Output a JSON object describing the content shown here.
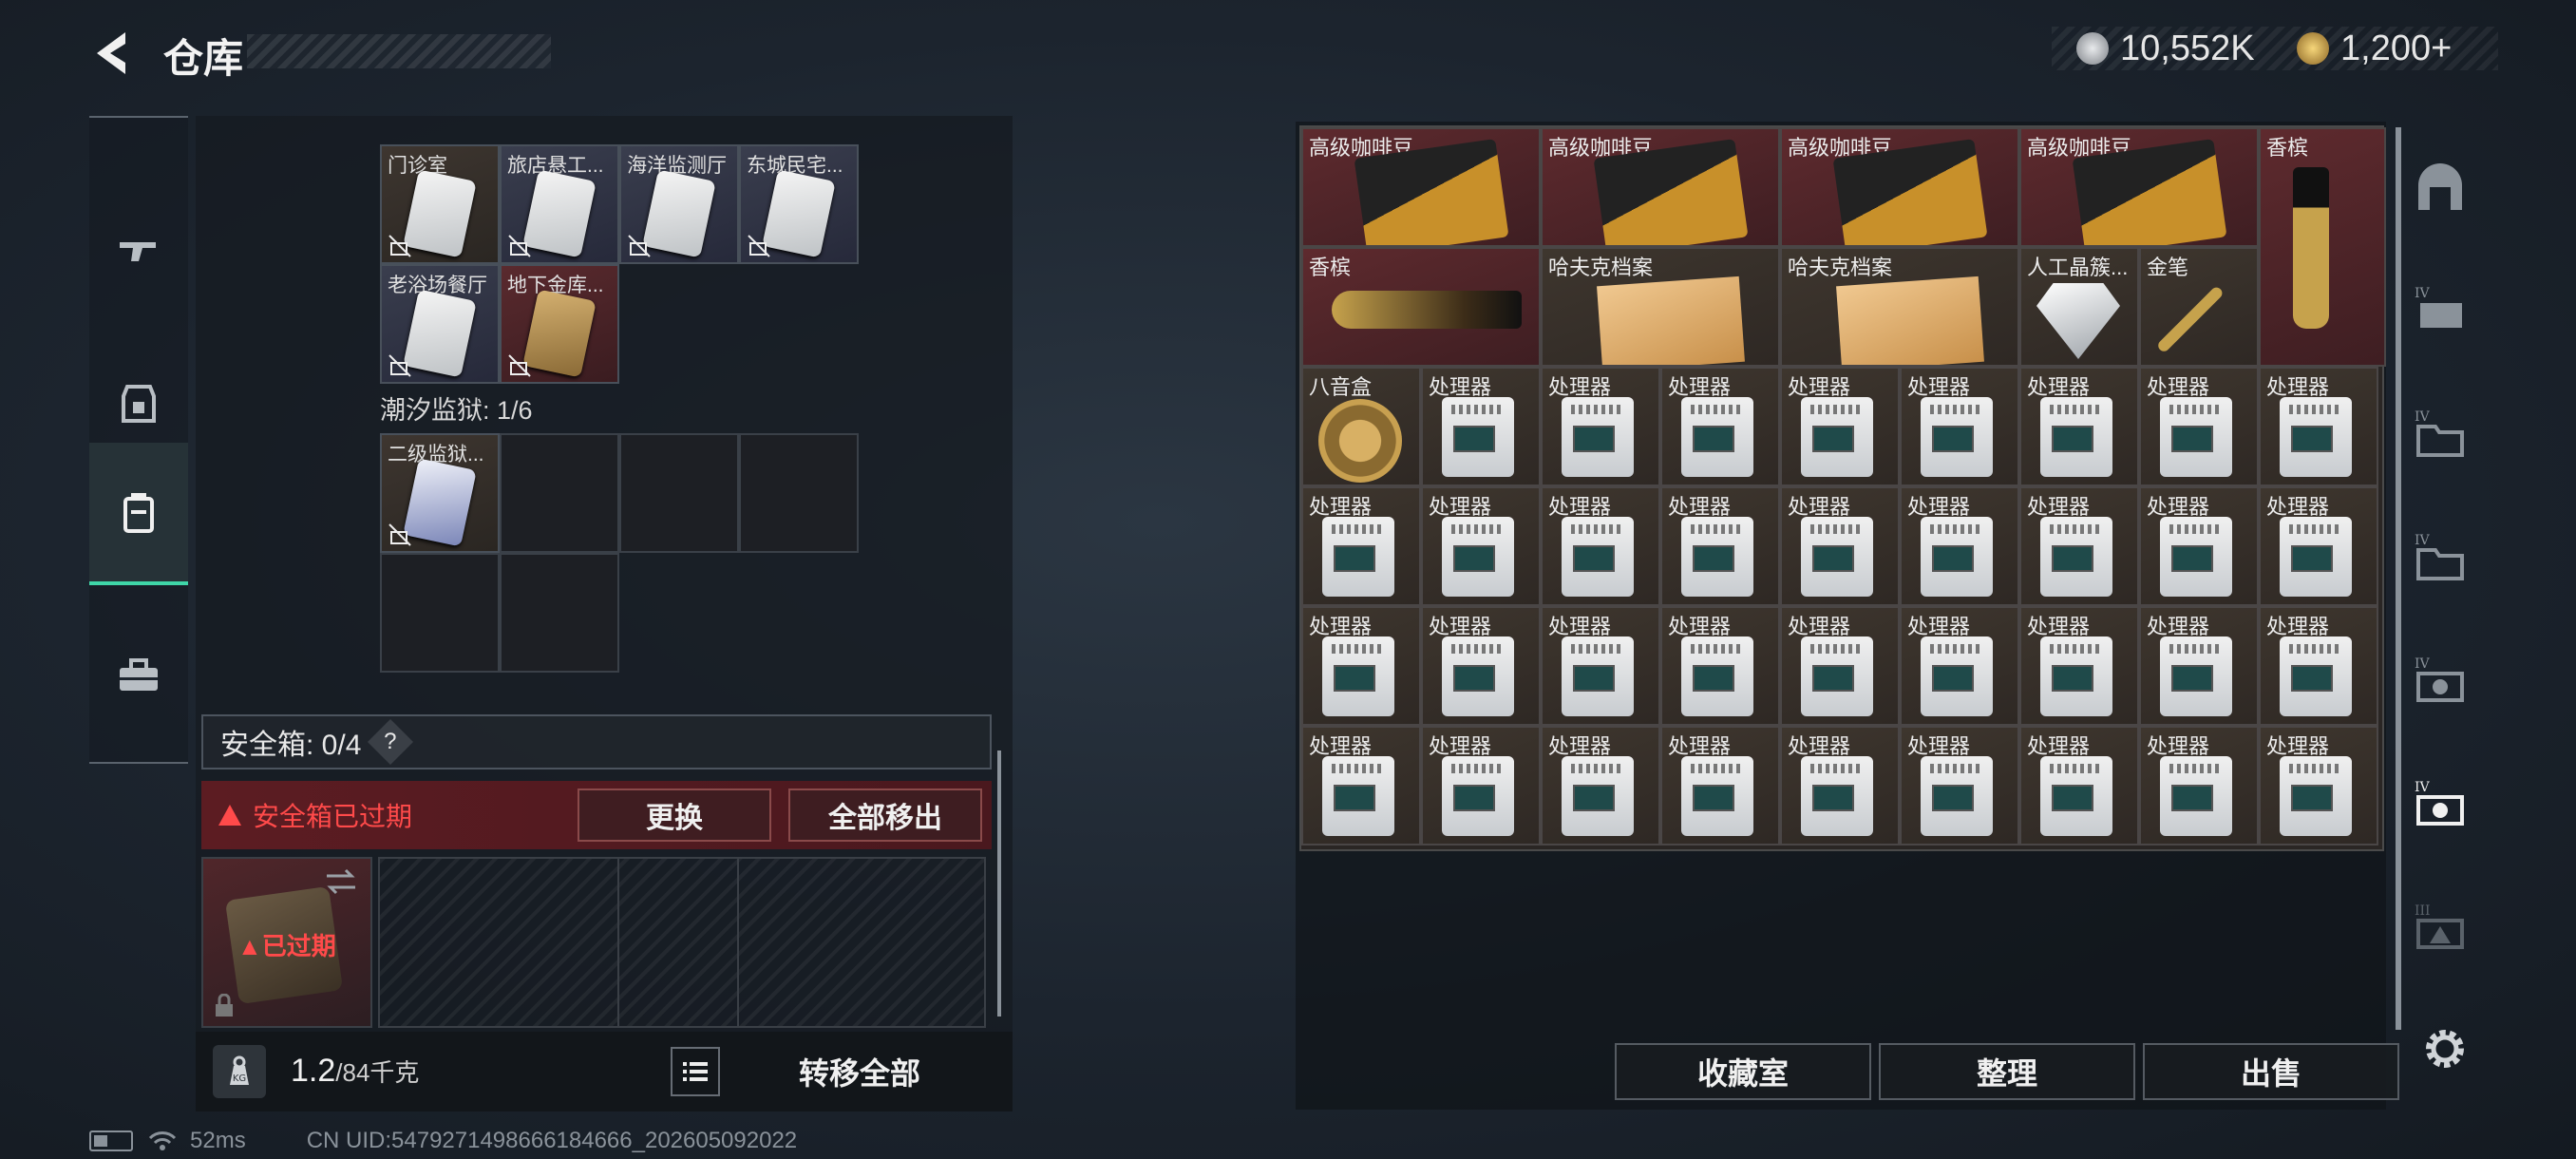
{
  "header": {
    "title": "仓库",
    "currencies": [
      {
        "icon": "silver-coin-icon",
        "value": "10,552K",
        "color": "#c0c4c8"
      },
      {
        "icon": "gold-coin-icon",
        "value": "1,200+",
        "color": "#d8b050"
      }
    ]
  },
  "left_nav": [
    {
      "icon": "gun-icon",
      "active": false
    },
    {
      "icon": "armor-icon",
      "active": false
    },
    {
      "icon": "container-icon",
      "active": true
    },
    {
      "icon": "toolbox-icon",
      "active": false
    }
  ],
  "key_slots": [
    {
      "label": "门诊室",
      "bg": "brown"
    },
    {
      "label": "旅店悬工...",
      "bg": "blue"
    },
    {
      "label": "海洋监测厅",
      "bg": "blue"
    },
    {
      "label": "东城民宅...",
      "bg": "blue"
    },
    {
      "label": "老浴场餐厅",
      "bg": "blue"
    },
    {
      "label": "地下金库...",
      "bg": "red"
    }
  ],
  "prison_section": {
    "label": "潮汐监狱: 1/6",
    "slots": [
      {
        "label": "二级监狱..."
      }
    ]
  },
  "safe_box": {
    "label": "安全箱: 0/4",
    "help": "?",
    "expired_message": "安全箱已过期",
    "replace_button": "更换",
    "remove_all_button": "全部移出",
    "case_status": "已过期"
  },
  "weight": {
    "current": "1.2",
    "capacity": "/84千克",
    "icon_label": "KG"
  },
  "transfer_all_button": "转移全部",
  "inventory": {
    "row1": [
      {
        "label": "高级咖啡豆",
        "item": "coffee"
      },
      {
        "label": "高级咖啡豆",
        "item": "coffee"
      },
      {
        "label": "高级咖啡豆",
        "item": "coffee"
      },
      {
        "label": "高级咖啡豆",
        "item": "coffee"
      },
      {
        "label": "香槟",
        "item": "champagne-vertical"
      }
    ],
    "row2": [
      {
        "label": "香槟",
        "item": "champagne"
      },
      {
        "label": "哈夫克档案",
        "item": "dossier"
      },
      {
        "label": "哈夫克档案",
        "item": "dossier"
      },
      {
        "label": "人工晶簇...",
        "item": "diamond"
      },
      {
        "label": "金笔",
        "item": "pen"
      }
    ],
    "music_box_label": "八音盒",
    "processor_label": "处理器"
  },
  "bottom_buttons": {
    "collection": "收藏室",
    "organize": "整理",
    "sell": "出售"
  },
  "right_nav": [
    {
      "icon": "arch-icon"
    },
    {
      "icon": "tier-4-storage-icon"
    },
    {
      "icon": "tier-4-folder-icon"
    },
    {
      "icon": "tier-4-folder-icon"
    },
    {
      "icon": "tier-4-device-icon"
    },
    {
      "icon": "tier-4-device-active-icon"
    },
    {
      "icon": "tier-3-device-icon"
    }
  ],
  "status_bar": {
    "ping": "52ms",
    "uid": "CN UID:5479271498666184666_202605092022"
  }
}
